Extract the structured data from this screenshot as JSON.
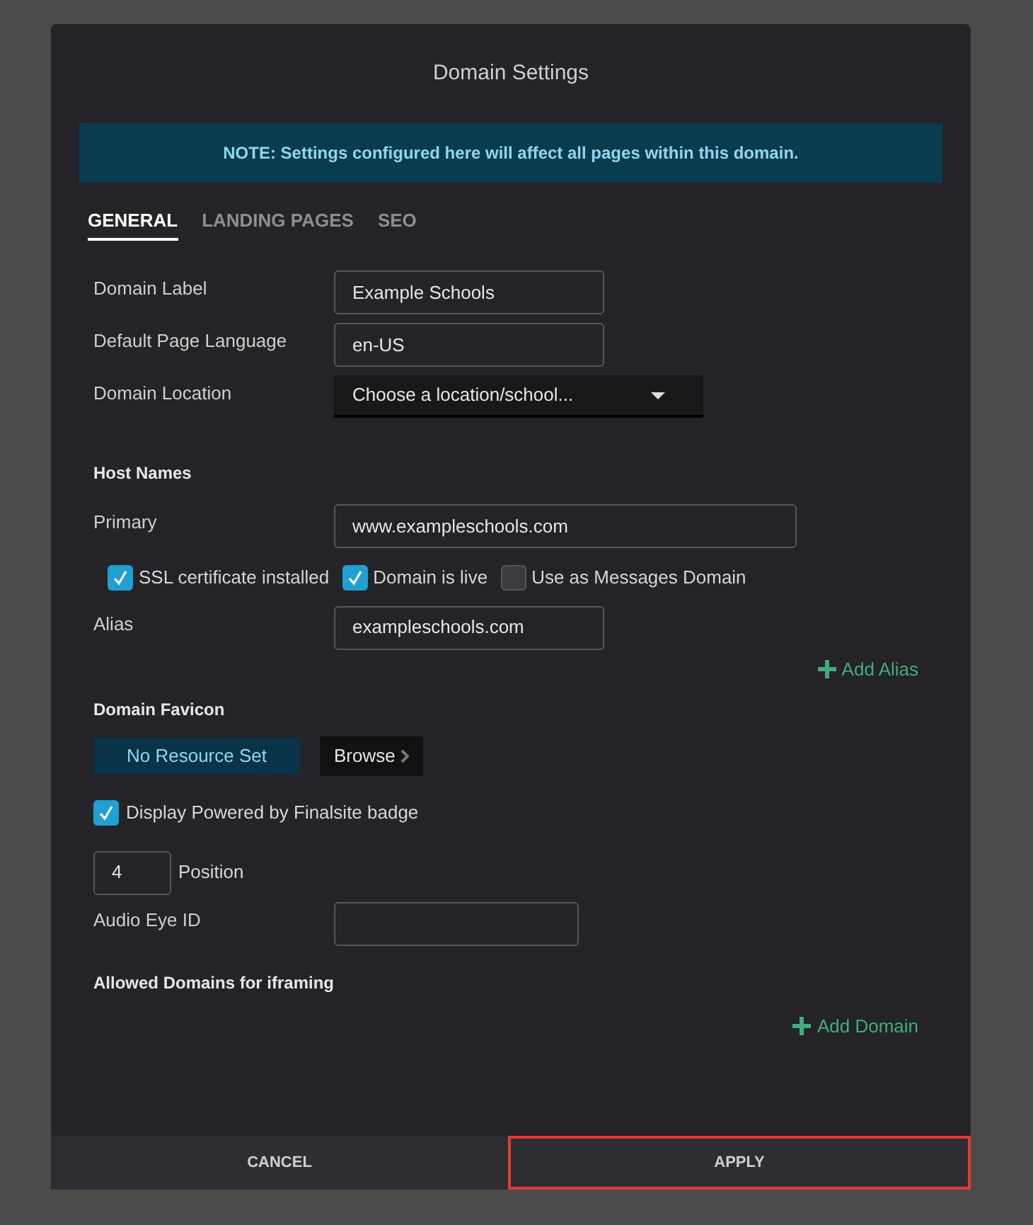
{
  "dialog": {
    "title": "Domain Settings"
  },
  "note": "NOTE: Settings configured here will affect all pages within this domain.",
  "tabs": [
    {
      "label": "GENERAL",
      "selected": true
    },
    {
      "label": "LANDING PAGES",
      "selected": false
    },
    {
      "label": "SEO",
      "selected": false
    }
  ],
  "fields": [
    {
      "kind": "text",
      "label": "Domain Label",
      "value": "Example Schools"
    },
    {
      "kind": "text",
      "label": "Default Page Language",
      "value": "en-US"
    },
    {
      "kind": "select",
      "label": "Domain Location",
      "value": "Choose a location/school..."
    }
  ],
  "host_names": {
    "heading": "Host Names",
    "primary_label": "Primary",
    "primary_value": "www.exampleschools.com",
    "checkboxes": [
      {
        "label": "SSL certificate installed",
        "checked": true
      },
      {
        "label": "Domain is live",
        "checked": true
      },
      {
        "label": "Use as Messages Domain",
        "checked": false
      }
    ],
    "alias_label": "Alias",
    "alias_value": "exampleschools.com",
    "add_alias": "Add Alias"
  },
  "favicon": {
    "heading": "Domain Favicon",
    "resource": "No Resource Set",
    "browse": "Browse"
  },
  "badge_checkbox": {
    "label": "Display Powered by Finalsite badge",
    "checked": true
  },
  "position": {
    "value": "4",
    "label": "Position"
  },
  "audio_eye": {
    "label": "Audio Eye ID"
  },
  "iframing": {
    "heading": "Allowed Domains for iframing",
    "add_domain": "Add Domain"
  },
  "buttons": [
    {
      "label": "CANCEL",
      "highlighted": false
    },
    {
      "label": "APPLY",
      "highlighted": true
    }
  ]
}
